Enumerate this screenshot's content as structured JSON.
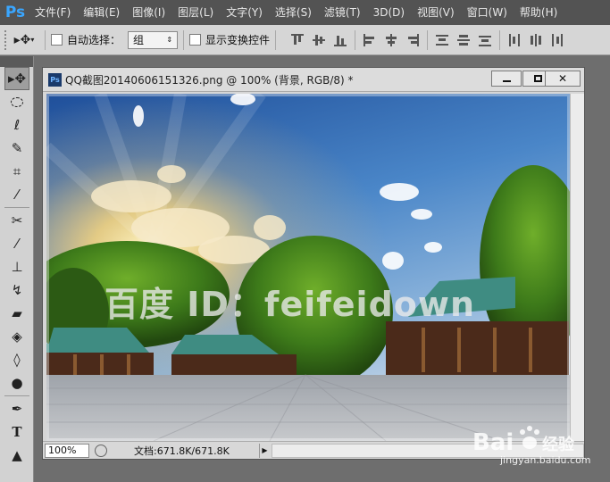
{
  "app": {
    "logo": "Ps"
  },
  "menu": [
    "文件(F)",
    "编辑(E)",
    "图像(I)",
    "图层(L)",
    "文字(Y)",
    "选择(S)",
    "滤镜(T)",
    "3D(D)",
    "视图(V)",
    "窗口(W)",
    "帮助(H)"
  ],
  "options": {
    "auto_select_label": "自动选择：",
    "auto_select_value": "组",
    "show_transform_label": "显示变换控件"
  },
  "document": {
    "ps_icon": "Ps",
    "title": "QQ截图20140606151326.png @ 100% (背景, RGB/8) *",
    "zoom": "100%",
    "doc_info": "文档:671.8K/671.8K"
  },
  "watermark": {
    "overlay": "百度 ID：feifeidown",
    "brand": "Bai",
    "brand_cn": "经验",
    "url": "jingyan.baidu.com"
  },
  "icons": {
    "tools": [
      "move-tool-icon",
      "marquee-tool-icon",
      "lasso-tool-icon",
      "quick-select-tool-icon",
      "crop-tool-icon",
      "eyedropper-tool-icon",
      "healing-brush-tool-icon",
      "brush-tool-icon",
      "clone-stamp-tool-icon",
      "history-brush-tool-icon",
      "eraser-tool-icon",
      "paint-bucket-tool-icon",
      "blur-tool-icon",
      "dodge-tool-icon",
      "pen-tool-icon",
      "type-tool-icon",
      "path-select-tool-icon"
    ]
  },
  "colors": {
    "menubar": "#535353",
    "logo": "#3aa6ff",
    "panel": "#d6d6d6"
  }
}
